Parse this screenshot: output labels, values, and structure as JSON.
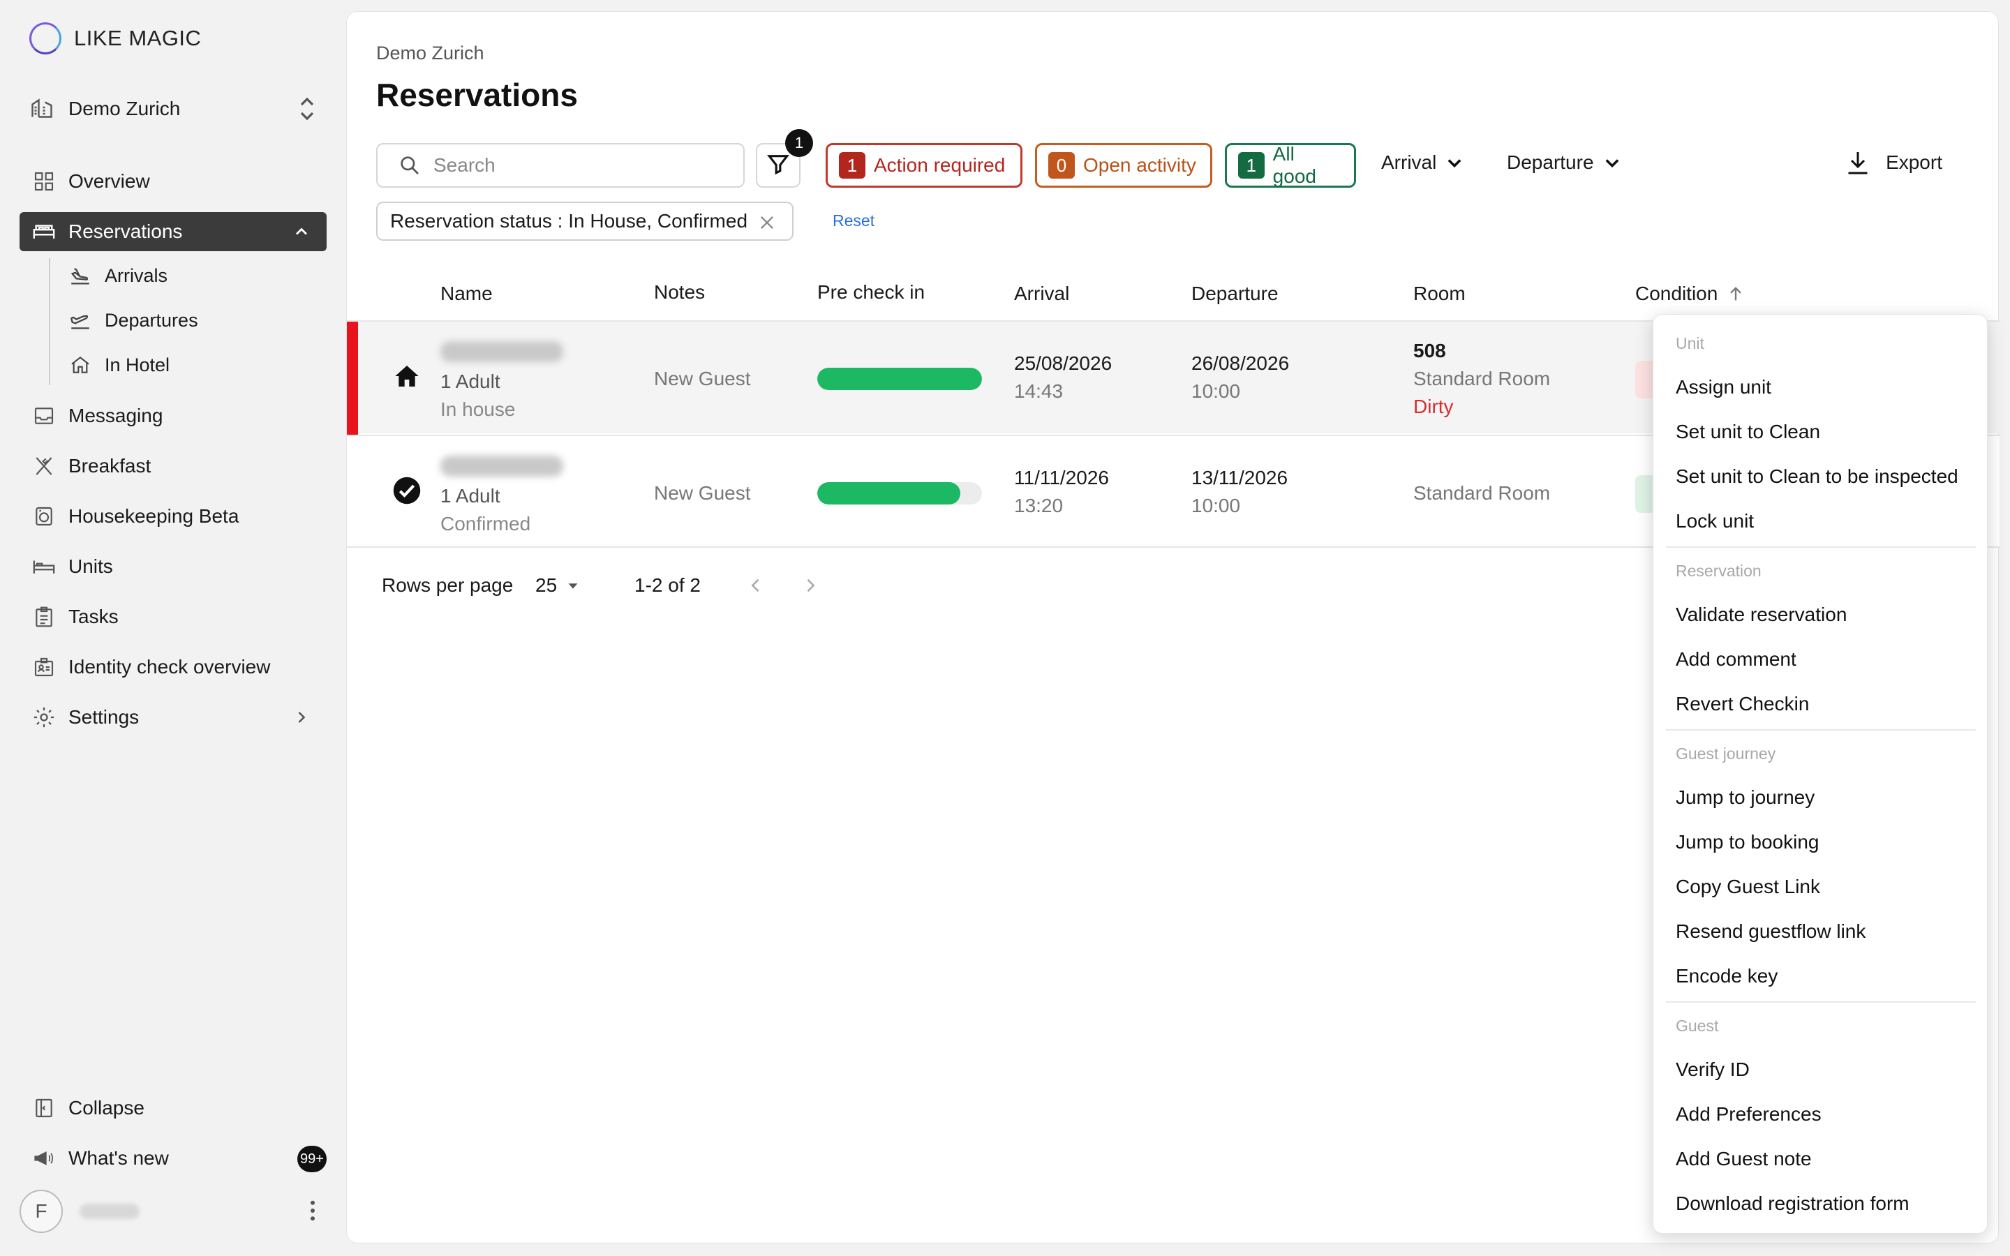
{
  "brand": {
    "name": "LIKE MAGIC"
  },
  "sidebar": {
    "property": "Demo Zurich",
    "items": [
      {
        "label": "Overview"
      },
      {
        "label": "Reservations"
      },
      {
        "label": "Messaging"
      },
      {
        "label": "Breakfast"
      },
      {
        "label": "Housekeeping Beta"
      },
      {
        "label": "Units"
      },
      {
        "label": "Tasks"
      },
      {
        "label": "Identity check overview"
      },
      {
        "label": "Settings"
      }
    ],
    "sub_items": [
      {
        "label": "Arrivals"
      },
      {
        "label": "Departures"
      },
      {
        "label": "In Hotel"
      }
    ],
    "collapse": "Collapse",
    "whats_new": "What's new",
    "whats_new_badge": "99+",
    "user_initial": "F"
  },
  "header": {
    "breadcrumb": "Demo Zurich",
    "title": "Reservations"
  },
  "toolbar": {
    "search_placeholder": "Search",
    "filter_count": "1",
    "chips": {
      "action_required": {
        "count": "1",
        "label": "Action required"
      },
      "open_activity": {
        "count": "0",
        "label": "Open activity"
      },
      "all_good": {
        "count": "1",
        "label": "All good"
      }
    },
    "arrival": "Arrival",
    "departure": "Departure",
    "export": "Export",
    "status_filter": "Reservation status : In House, Confirmed",
    "reset": "Reset"
  },
  "table": {
    "columns": [
      "Name",
      "Notes",
      "Pre check in",
      "Arrival",
      "Departure",
      "Room",
      "Condition"
    ],
    "rows": [
      {
        "guests": "1 Adult",
        "status": "In house",
        "notes": "New Guest",
        "precheck_progress": 1.0,
        "arrival_date": "25/08/2026",
        "arrival_time": "14:43",
        "departure_date": "26/08/2026",
        "departure_time": "10:00",
        "room_number": "508",
        "room_type": "Standard Room",
        "room_state": "Dirty",
        "condition_color": "#fde2e2"
      },
      {
        "guests": "1 Adult",
        "status": "Confirmed",
        "notes": "New Guest",
        "precheck_progress": 0.87,
        "arrival_date": "11/11/2026",
        "arrival_time": "13:20",
        "departure_date": "13/11/2026",
        "departure_time": "10:00",
        "room_type": "Standard Room",
        "condition_color": "#dff3e6"
      }
    ]
  },
  "pagination": {
    "rows_per_page_label": "Rows per page",
    "rows_per_page": "25",
    "range": "1-2 of 2"
  },
  "menu": {
    "unit_header": "Unit",
    "unit_items": [
      "Assign unit",
      "Set unit to Clean",
      "Set unit to Clean to be inspected",
      "Lock unit"
    ],
    "reservation_header": "Reservation",
    "reservation_items": [
      "Validate reservation",
      "Add comment",
      "Revert Checkin"
    ],
    "journey_header": "Guest journey",
    "journey_items": [
      "Jump to journey",
      "Jump to booking",
      "Copy Guest Link",
      "Resend guestflow link",
      "Encode key"
    ],
    "guest_header": "Guest",
    "guest_items": [
      "Verify ID",
      "Add Preferences",
      "Add Guest note",
      "Download registration form"
    ]
  },
  "colors": {
    "accent_red": "#b3261e",
    "alert_bar": "#e8141b",
    "progress_green": "#1db863",
    "dirty_red": "#d32f2f"
  }
}
